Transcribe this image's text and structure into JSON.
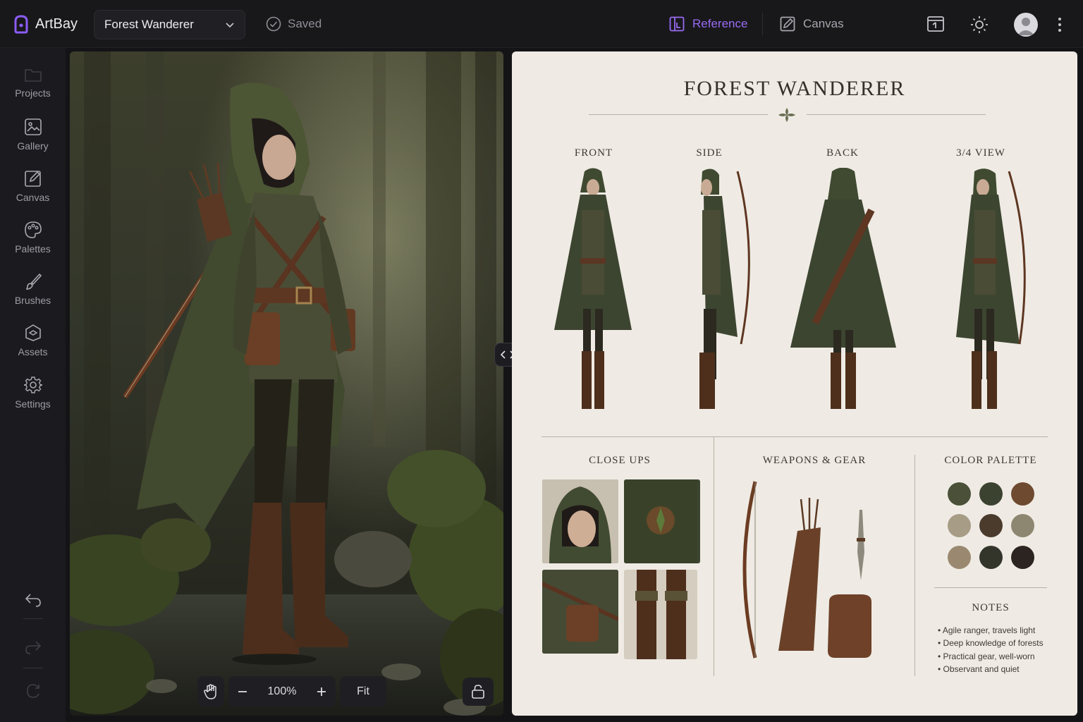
{
  "app": {
    "name": "ArtBay"
  },
  "header": {
    "project_name": "Forest Wanderer",
    "save_status": "Saved",
    "modes": [
      {
        "label": "Reference",
        "active": true
      },
      {
        "label": "Canvas",
        "active": false
      }
    ]
  },
  "sidebar": {
    "items": [
      {
        "label": "Projects",
        "icon": "folder-icon"
      },
      {
        "label": "Gallery",
        "icon": "image-icon"
      },
      {
        "label": "Canvas",
        "icon": "edit-icon"
      },
      {
        "label": "Palettes",
        "icon": "palette-icon"
      },
      {
        "label": "Brushes",
        "icon": "brush-icon"
      },
      {
        "label": "Assets",
        "icon": "cube-icon"
      },
      {
        "label": "Settings",
        "icon": "gear-icon"
      }
    ]
  },
  "viewer": {
    "zoom": "100%",
    "fit_label": "Fit"
  },
  "sheet": {
    "title": "FOREST WANDERER",
    "views": [
      "FRONT",
      "SIDE",
      "BACK",
      "3/4 VIEW"
    ],
    "sections": {
      "closeups": "CLOSE UPS",
      "gear": "WEAPONS & GEAR",
      "palette": "COLOR PALETTE"
    },
    "palette": [
      "#4a5138",
      "#3c4230",
      "#6e4a30",
      "#a79c86",
      "#4b3b2c",
      "#8d8670",
      "#9a8870",
      "#33342a",
      "#2c2420"
    ],
    "notes_title": "NOTES",
    "notes": [
      "Agile ranger, travels light",
      "Deep knowledge of forests",
      "Practical gear, well-worn",
      "Observant and quiet"
    ]
  },
  "colors": {
    "accent": "#9a6cf2",
    "panel_bg": "#efebe4",
    "app_bg": "#141417"
  }
}
